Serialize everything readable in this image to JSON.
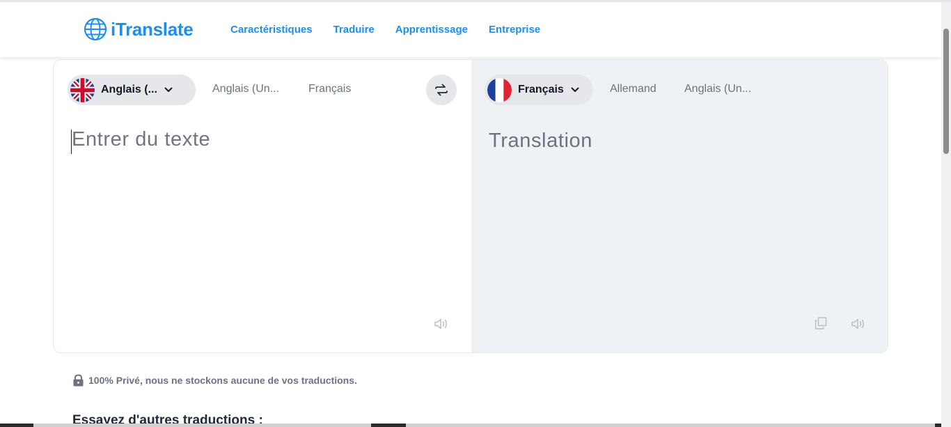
{
  "header": {
    "logo_text": "iTranslate",
    "nav": [
      {
        "label": "Caractéristiques"
      },
      {
        "label": "Traduire"
      },
      {
        "label": "Apprentissage"
      },
      {
        "label": "Entreprise"
      }
    ]
  },
  "source": {
    "selected_language": "Anglais (...",
    "selected_flag": "uk-flag-icon",
    "quick_languages": [
      "Anglais (Un...",
      "Français"
    ],
    "placeholder": "Entrer du texte",
    "value": ""
  },
  "target": {
    "selected_language": "Français",
    "selected_flag": "france-flag-icon",
    "quick_languages": [
      "Allemand",
      "Anglais (Un..."
    ],
    "placeholder": "Translation"
  },
  "footer": {
    "privacy": "100% Privé, nous ne stockons aucune de vos traductions.",
    "try_other": "Essayez d'autres traductions :"
  },
  "colors": {
    "brand": "#1d8ee9",
    "pill_bg": "#e5e7eb",
    "target_pane_bg": "#eff2f5"
  }
}
